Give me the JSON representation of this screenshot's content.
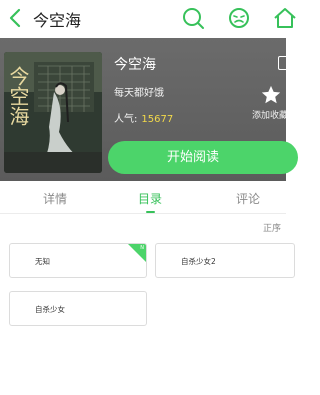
{
  "header": {
    "title": "今空海",
    "icons": [
      "back-arrow-icon",
      "search-icon",
      "face-icon",
      "home-icon"
    ]
  },
  "book": {
    "title": "今空海",
    "author": "每天都好饿",
    "popularity_label": "人气:",
    "popularity_value": "15677",
    "favorite_label": "添加收藏",
    "read_button": "开始阅读",
    "cover_text": "今空海"
  },
  "tabs": [
    {
      "label": "详情",
      "active": false
    },
    {
      "label": "目录",
      "active": true
    },
    {
      "label": "评论",
      "active": false
    }
  ],
  "sort_label": "正序",
  "chapters": [
    {
      "title": "无知",
      "new": true
    },
    {
      "title": "自杀少女2",
      "new": false
    },
    {
      "title": "自杀少女",
      "new": false
    }
  ],
  "new_badge": "N",
  "colors": {
    "accent": "#4cd46a",
    "popularity": "#f2d94a",
    "hero_bg": "#666666"
  }
}
